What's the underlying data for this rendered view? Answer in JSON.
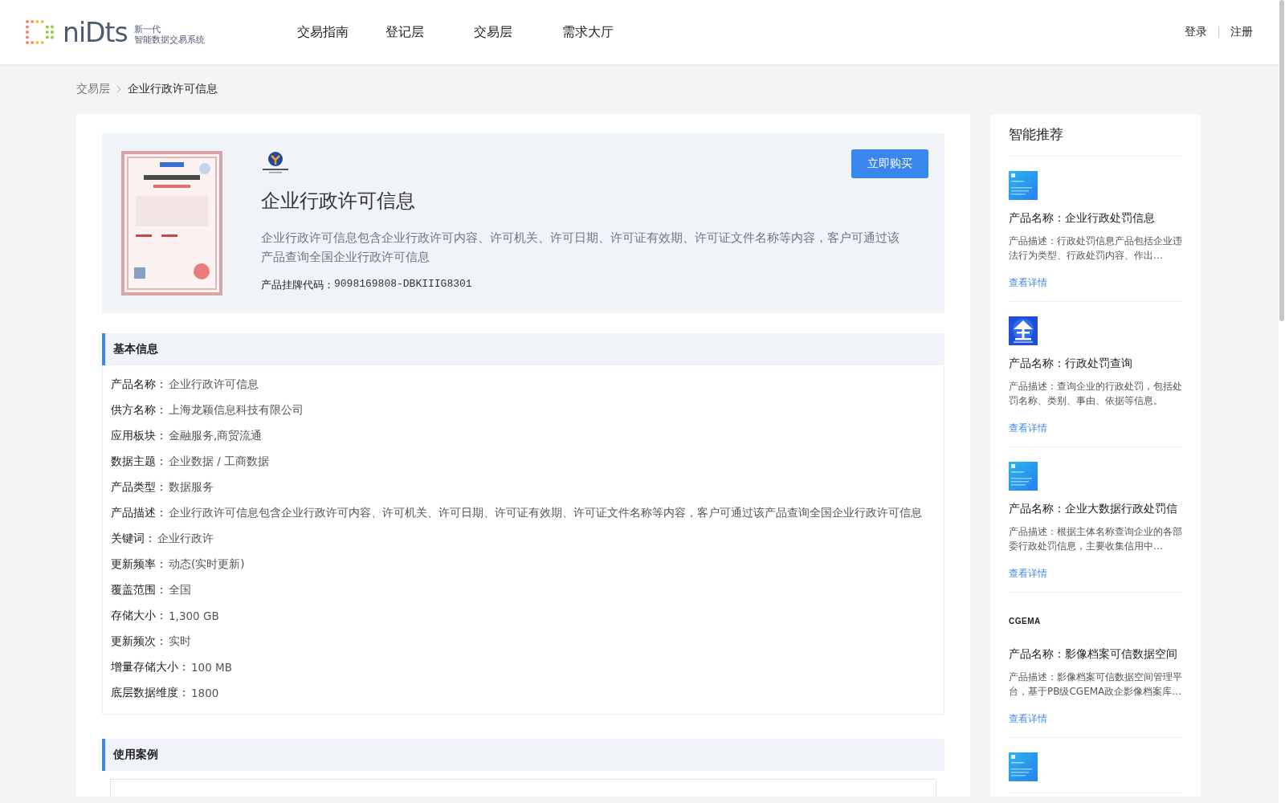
{
  "header": {
    "logo": {
      "wordmark": "niDts",
      "tagline_1": "新一代",
      "tagline_2": "智能数据交易系统"
    },
    "nav": [
      {
        "label": "交易指南"
      },
      {
        "label": "登记层"
      },
      {
        "label": "交易层"
      },
      {
        "label": "需求大厅"
      }
    ],
    "auth": [
      {
        "label": "登录"
      },
      {
        "label": "注册"
      }
    ]
  },
  "breadcrumb": [
    {
      "label": "交易层"
    },
    {
      "label": "企业行政许可信息"
    }
  ],
  "product": {
    "title": "企业行政许可信息",
    "description": "企业行政许可信息包含企业行政许可内容、许可机关、许可日期、许可证有效期、许可证文件名称等内容，客户可通过该产品查询全国企业行政许可信息",
    "code_label": "产品挂牌代码：",
    "code": "9098169808-DBKIIIG8301",
    "buy_button": "立即购买"
  },
  "basic_info": {
    "title": "基本信息",
    "fields": [
      {
        "label": "产品名称：",
        "value": "企业行政许可信息"
      },
      {
        "label": "供方名称：",
        "value": "上海龙颖信息科技有限公司"
      },
      {
        "label": "应用板块：",
        "value": "金融服务,商贸流通"
      },
      {
        "label": "数据主题：",
        "value": "企业数据 / 工商数据"
      },
      {
        "label": "产品类型：",
        "value": "数据服务"
      },
      {
        "label": "产品描述：",
        "value": "企业行政许可信息包含企业行政许可内容、许可机关、许可日期、许可证有效期、许可证文件名称等内容，客户可通过该产品查询全国企业行政许可信息"
      },
      {
        "label": "关键词：",
        "value": "企业行政许"
      },
      {
        "label": "更新频率：",
        "value": "动态(实时更新)"
      },
      {
        "label": "覆盖范围：",
        "value": "全国"
      },
      {
        "label": "存储大小：",
        "value": "1,300 GB"
      },
      {
        "label": "更新频次：",
        "value": "实时"
      },
      {
        "label": "增量存储大小：",
        "value": "100 MB"
      },
      {
        "label": "底层数据维度：",
        "value": "1800"
      }
    ]
  },
  "use_cases": {
    "title": "使用案例"
  },
  "recommendations": {
    "title": "智能推荐",
    "items": [
      {
        "thumb": {
          "kind": "picture"
        },
        "name": "产品名称：企业行政处罚信息",
        "description": "产品描述：行政处罚信息产品包括企业违法行为类型、行政处罚内容、作出…",
        "link": "查看详情"
      },
      {
        "thumb": {
          "kind": "emblem"
        },
        "name": "产品名称：行政处罚查询",
        "description": "产品描述：查询企业的行政处罚，包括处罚名称、类别、事由、依据等信息。",
        "link": "查看详情"
      },
      {
        "thumb": {
          "kind": "picture"
        },
        "name": "产品名称：企业大数据行政处罚信",
        "description": "产品描述：根据主体名称查询企业的各部委行政处罚信息，主要收集信用中…",
        "link": "查看详情"
      },
      {
        "thumb": {
          "kind": "logo",
          "text": "CGEMA"
        },
        "name": "产品名称：影像档案可信数据空间",
        "description": "产品描述：影像档案可信数据空间管理平台，基于PB级CGEMA政企影像档案库…",
        "link": "查看详情"
      },
      {
        "thumb": {
          "kind": "picture"
        }
      }
    ]
  }
}
